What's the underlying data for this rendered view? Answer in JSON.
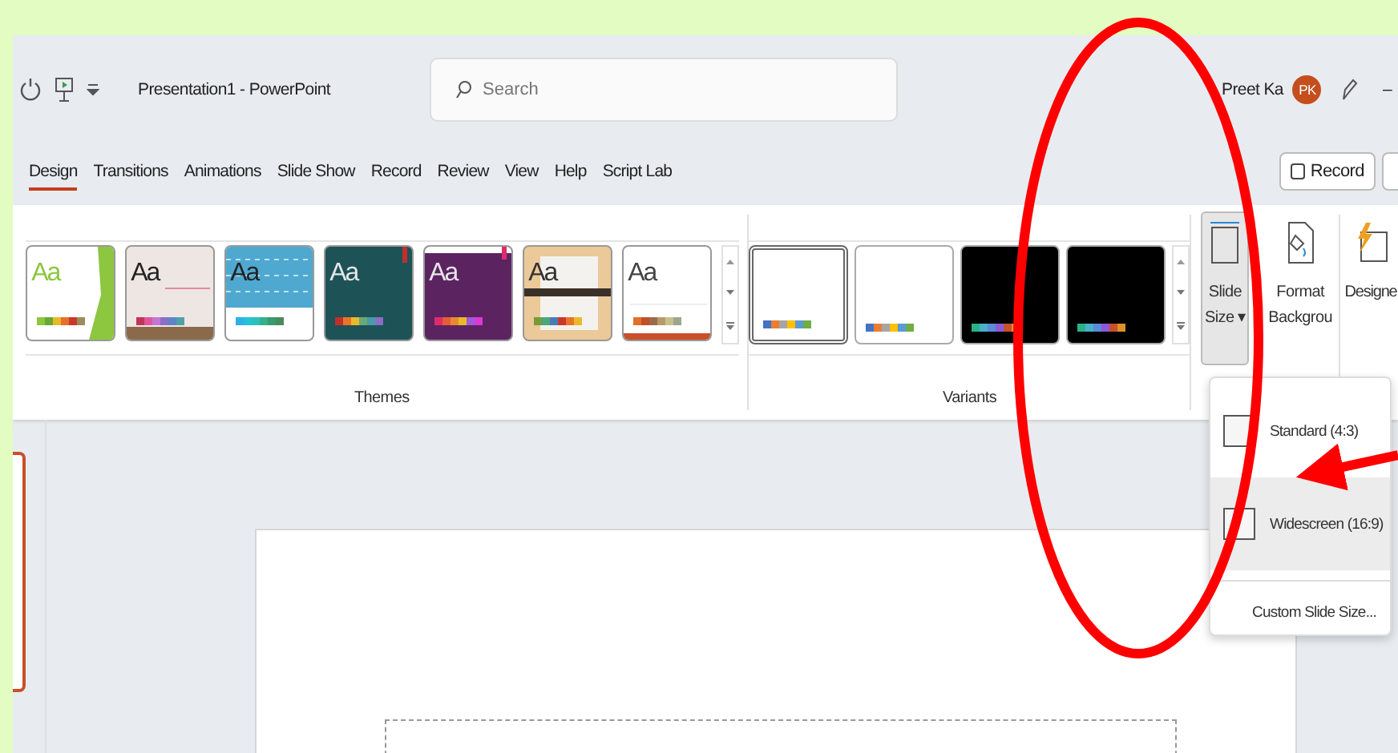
{
  "title_bar": {
    "title": "Presentation1 - PowerPoint",
    "search": {
      "placeholder": "Search"
    },
    "user": {
      "name": "Preet Ka",
      "initials": "PK"
    },
    "minimize": "–"
  },
  "tabs": [
    {
      "label": "Design",
      "selected": true
    },
    {
      "label": "Transitions",
      "selected": false
    },
    {
      "label": "Animations",
      "selected": false
    },
    {
      "label": "Slide Show",
      "selected": false
    },
    {
      "label": "Record",
      "selected": false
    },
    {
      "label": "Review",
      "selected": false
    },
    {
      "label": "View",
      "selected": false
    },
    {
      "label": "Help",
      "selected": false
    },
    {
      "label": "Script Lab",
      "selected": false
    }
  ],
  "record_button": {
    "label": "Record"
  },
  "themes": {
    "label": "Themes",
    "items": [
      {
        "sample": "Aa",
        "kind": "green"
      },
      {
        "sample": "Aa",
        "kind": "blush"
      },
      {
        "sample": "Aa",
        "kind": "pattern"
      },
      {
        "sample": "Aa",
        "kind": "teal"
      },
      {
        "sample": "Aa",
        "kind": "purple"
      },
      {
        "sample": "Aa",
        "kind": "wood"
      },
      {
        "sample": "Aa",
        "kind": "plain"
      }
    ]
  },
  "variants": {
    "label": "Variants",
    "items": [
      {
        "selected": true,
        "kind": "light"
      },
      {
        "selected": false,
        "kind": "light"
      },
      {
        "selected": false,
        "kind": "dark"
      },
      {
        "selected": false,
        "kind": "dark"
      }
    ]
  },
  "ribbon_buttons": [
    {
      "label": "Slide Size",
      "caret": "▾",
      "pressed": true,
      "kind": "slide-size"
    },
    {
      "label": "Format Backgrou",
      "pressed": false,
      "kind": "format-background"
    },
    {
      "label": "Designe",
      "pressed": false,
      "kind": "designer"
    }
  ],
  "slide_size_menu": [
    {
      "kind": "option",
      "label": "Standard (4:3)",
      "selected": false
    },
    {
      "kind": "option",
      "label": "Widescreen (16:9)",
      "selected": true
    },
    {
      "kind": "command",
      "label": "Custom Slide Size..."
    }
  ]
}
